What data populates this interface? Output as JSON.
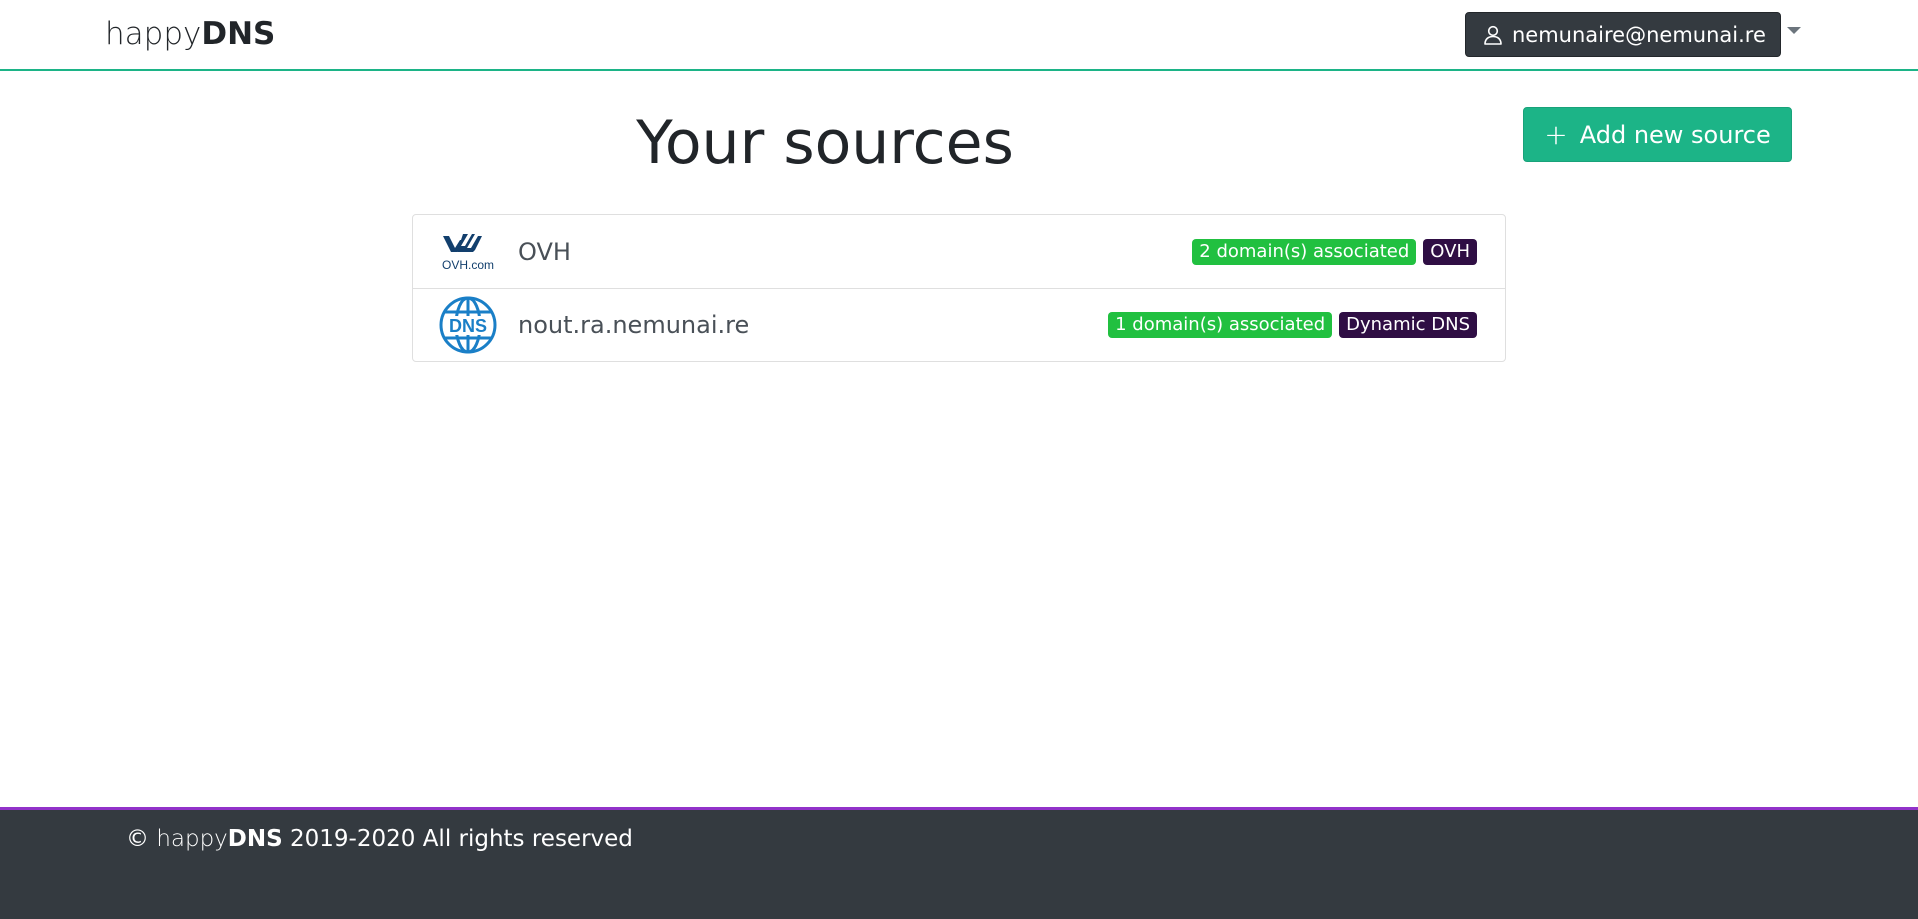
{
  "header": {
    "brand_light": "happy",
    "brand_bold": "DNS",
    "user_email": "nemunaire@nemunai.re",
    "user_icon": "person-icon",
    "menu_icon": "caret-down-icon"
  },
  "main": {
    "title": "Your sources",
    "add_button": {
      "icon": "plus-icon",
      "icon_glyph": "+",
      "label": "Add new source"
    },
    "sources": [
      {
        "name": "OVH",
        "logo": "ovh-logo",
        "logo_text": "OVH.com",
        "domains_badge": "2 domain(s) associated",
        "provider_badge": "OVH"
      },
      {
        "name": "nout.ra.nemunai.re",
        "logo": "dns-globe-icon",
        "logo_text": "DNS",
        "domains_badge": "1 domain(s) associated",
        "provider_badge": "Dynamic DNS"
      }
    ]
  },
  "footer": {
    "copyright_symbol": "©",
    "brand_light": "happy",
    "brand_bold": "DNS",
    "rights": "2019-2020 All rights reserved"
  },
  "colors": {
    "accent": "#1cb487",
    "success_badge": "#21c040",
    "provider_badge": "#2f0e44",
    "footer_bg": "#343a40",
    "footer_border": "#9232c9",
    "user_button_bg": "#343a40"
  }
}
